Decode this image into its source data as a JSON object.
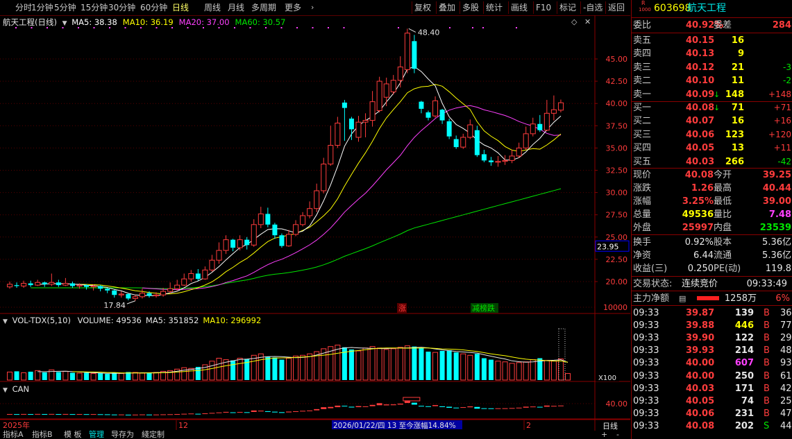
{
  "toolbar": {
    "periods": [
      "分时",
      "1分钟",
      "5分钟",
      "15分钟",
      "30分钟",
      "60分钟",
      "日线",
      "周线",
      "月线",
      "多周期",
      "更多"
    ],
    "active_period": "日线",
    "tools": [
      "复权",
      "叠加",
      "多股",
      "统计",
      "画线",
      "F10",
      "标记",
      "-自选",
      "返回"
    ]
  },
  "main_chart": {
    "stock_label": "航天工程(日线)",
    "ma_items": [
      {
        "label": "MA5: 38.38",
        "color": "#ffffff"
      },
      {
        "label": "MA10: 36.19",
        "color": "#ffff00"
      },
      {
        "label": "MA20: 37.00",
        "color": "#ff40ff"
      },
      {
        "label": "MA60: 30.57",
        "color": "#00e600"
      }
    ],
    "high_label": "48.40",
    "low_label": "17.84",
    "y_ticks": [
      "45.00",
      "42.50",
      "40.00",
      "37.50",
      "35.00",
      "32.50",
      "30.00",
      "27.50",
      "25.00",
      "22.50",
      "20.00"
    ],
    "price_tag": "23.95",
    "tag_zhang": "涨",
    "tag_longhu": "减榜跌"
  },
  "vol_chart": {
    "title": "VOL-TDX(5,10)",
    "items": [
      {
        "label": "VOLUME: 49536",
        "color": "#e6e6e6"
      },
      {
        "label": "MA5: 351852",
        "color": "#e6e6e6"
      },
      {
        "label": "MA10: 296992",
        "color": "#ffff00"
      }
    ],
    "y_tick": "10000",
    "unit": "X100"
  },
  "can_chart": {
    "title": "CAN",
    "y_tick": "40.00"
  },
  "x_axis": {
    "year_label": "2025年",
    "m1": "12",
    "m2": "2",
    "tooltip": "2026/01/22/四 13 至今涨幅14.84%",
    "period_label": "日线"
  },
  "bottom_tabs": [
    "指标A",
    "指标B",
    "模 板",
    "管理",
    "导存为",
    "綫定制"
  ],
  "bottom_right": [
    "+",
    "-"
  ],
  "quote": {
    "code": "603698",
    "name": "航天工程",
    "badge_top": "R",
    "badge_bottom": "1000",
    "weibi_label": "委比",
    "weibi": "40.92%",
    "weicha_label": "委差",
    "weicha": "284",
    "sell": [
      {
        "label": "卖五",
        "price": "40.15",
        "vol": "16",
        "chg": ""
      },
      {
        "label": "卖四",
        "price": "40.13",
        "vol": "9",
        "chg": ""
      },
      {
        "label": "卖三",
        "price": "40.12",
        "vol": "21",
        "chg": "-3"
      },
      {
        "label": "卖二",
        "price": "40.10",
        "vol": "11",
        "chg": "-2"
      },
      {
        "label": "卖一",
        "price": "40.09",
        "vol": "148",
        "chg": "+148"
      }
    ],
    "buy": [
      {
        "label": "买一",
        "price": "40.08",
        "vol": "71",
        "chg": "+71"
      },
      {
        "label": "买二",
        "price": "40.07",
        "vol": "16",
        "chg": "+16"
      },
      {
        "label": "买三",
        "price": "40.06",
        "vol": "123",
        "chg": "+120"
      },
      {
        "label": "买四",
        "price": "40.05",
        "vol": "13",
        "chg": "+11"
      },
      {
        "label": "买五",
        "price": "40.03",
        "vol": "266",
        "chg": "-42"
      }
    ],
    "stats": [
      {
        "l1": "现价",
        "v1": "40.08",
        "c1": "red",
        "l2": "今开",
        "v2": "39.25",
        "c2": "red"
      },
      {
        "l1": "涨跌",
        "v1": "1.26",
        "c1": "red",
        "l2": "最高",
        "v2": "40.44",
        "c2": "red"
      },
      {
        "l1": "涨幅",
        "v1": "3.25%",
        "c1": "red",
        "l2": "最低",
        "v2": "39.00",
        "c2": "red"
      },
      {
        "l1": "总量",
        "v1": "49536",
        "c1": "yellow",
        "l2": "量比",
        "v2": "7.48",
        "c2": "magenta"
      },
      {
        "l1": "外盘",
        "v1": "25997",
        "c1": "red",
        "l2": "内盘",
        "v2": "23539",
        "c2": "green"
      }
    ],
    "stats2": [
      {
        "l1": "换手",
        "v1": "0.92%",
        "l2": "股本",
        "v2": "5.36亿"
      },
      {
        "l1": "净资",
        "v1": "6.44",
        "l2": "流通",
        "v2": "5.36亿"
      },
      {
        "l1": "收益(三)",
        "v1": "0.250",
        "l2": "PE(动)",
        "v2": "119.8"
      }
    ],
    "trade_status_label": "交易状态:",
    "trade_status": "连续竞价",
    "trade_time": "09:33:49",
    "main_net_label": "主力净额",
    "main_net": "1258万",
    "main_net_pct": "6%",
    "ticks": [
      {
        "t": "09:33",
        "p": "39.87",
        "v": "139",
        "s": "B",
        "n": "36",
        "vc": "white"
      },
      {
        "t": "09:33",
        "p": "39.88",
        "v": "446",
        "s": "B",
        "n": "77",
        "vc": "yellow"
      },
      {
        "t": "09:33",
        "p": "39.90",
        "v": "122",
        "s": "B",
        "n": "29",
        "vc": "white"
      },
      {
        "t": "09:33",
        "p": "39.93",
        "v": "214",
        "s": "B",
        "n": "48",
        "vc": "white"
      },
      {
        "t": "09:33",
        "p": "40.00",
        "v": "607",
        "s": "B",
        "n": "93",
        "vc": "magenta"
      },
      {
        "t": "09:33",
        "p": "40.00",
        "v": "250",
        "s": "B",
        "n": "61",
        "vc": "white"
      },
      {
        "t": "09:33",
        "p": "40.03",
        "v": "171",
        "s": "B",
        "n": "42",
        "vc": "white"
      },
      {
        "t": "09:33",
        "p": "40.05",
        "v": "74",
        "s": "B",
        "n": "25",
        "vc": "white"
      },
      {
        "t": "09:33",
        "p": "40.06",
        "v": "231",
        "s": "B",
        "n": "47",
        "vc": "white"
      },
      {
        "t": "09:33",
        "p": "40.08",
        "v": "202",
        "s": "S",
        "n": "44",
        "vc": "white"
      }
    ]
  },
  "colors": {
    "up": "#ff3c3c",
    "down": "#00ffff",
    "ma5": "#ffffff",
    "ma10": "#ffff00",
    "ma20": "#ff40ff",
    "ma60": "#00e600",
    "grid": "#5a0000"
  },
  "chart_data": {
    "type": "candlestick",
    "y_range": [
      17.0,
      49.0
    ],
    "candles": [
      {
        "o": 19.4,
        "c": 19.7,
        "h": 20.0,
        "l": 19.2
      },
      {
        "o": 19.6,
        "c": 19.5,
        "h": 19.9,
        "l": 19.3
      },
      {
        "o": 19.5,
        "c": 19.8,
        "h": 20.1,
        "l": 19.3
      },
      {
        "o": 19.8,
        "c": 19.6,
        "h": 20.1,
        "l": 19.4
      },
      {
        "o": 19.6,
        "c": 19.9,
        "h": 20.2,
        "l": 19.5
      },
      {
        "o": 19.9,
        "c": 19.7,
        "h": 20.0,
        "l": 19.4
      },
      {
        "o": 19.7,
        "c": 19.9,
        "h": 20.9,
        "l": 19.5
      },
      {
        "o": 19.9,
        "c": 19.6,
        "h": 20.2,
        "l": 19.4
      },
      {
        "o": 19.6,
        "c": 19.8,
        "h": 20.4,
        "l": 19.5
      },
      {
        "o": 19.8,
        "c": 19.5,
        "h": 20.0,
        "l": 19.3
      },
      {
        "o": 19.5,
        "c": 19.6,
        "h": 19.8,
        "l": 19.2
      },
      {
        "o": 19.6,
        "c": 19.4,
        "h": 19.7,
        "l": 19.1
      },
      {
        "o": 19.4,
        "c": 19.5,
        "h": 19.7,
        "l": 19.0
      },
      {
        "o": 19.5,
        "c": 19.2,
        "h": 19.6,
        "l": 18.9
      },
      {
        "o": 19.2,
        "c": 19.0,
        "h": 19.3,
        "l": 18.7
      },
      {
        "o": 19.0,
        "c": 18.5,
        "h": 19.1,
        "l": 18.2
      },
      {
        "o": 18.5,
        "c": 18.6,
        "h": 18.9,
        "l": 18.2
      },
      {
        "o": 18.6,
        "c": 18.1,
        "h": 18.7,
        "l": 17.9
      },
      {
        "o": 18.1,
        "c": 18.3,
        "h": 18.5,
        "l": 17.84
      },
      {
        "o": 18.3,
        "c": 18.7,
        "h": 19.2,
        "l": 18.1
      },
      {
        "o": 18.7,
        "c": 18.4,
        "h": 18.9,
        "l": 18.2
      },
      {
        "o": 18.4,
        "c": 18.5,
        "h": 18.8,
        "l": 18.2
      },
      {
        "o": 18.5,
        "c": 18.9,
        "h": 19.3,
        "l": 18.3
      },
      {
        "o": 18.9,
        "c": 19.2,
        "h": 19.9,
        "l": 18.7
      },
      {
        "o": 19.2,
        "c": 19.6,
        "h": 20.2,
        "l": 19.0
      },
      {
        "o": 19.6,
        "c": 20.3,
        "h": 20.9,
        "l": 19.5
      },
      {
        "o": 20.3,
        "c": 20.9,
        "h": 21.3,
        "l": 20.0
      },
      {
        "o": 20.9,
        "c": 20.3,
        "h": 21.4,
        "l": 20.1
      },
      {
        "o": 20.3,
        "c": 21.3,
        "h": 21.7,
        "l": 20.2
      },
      {
        "o": 21.3,
        "c": 22.4,
        "h": 23.0,
        "l": 21.1
      },
      {
        "o": 22.4,
        "c": 23.5,
        "h": 24.4,
        "l": 22.0
      },
      {
        "o": 23.5,
        "c": 24.7,
        "h": 25.2,
        "l": 23.1
      },
      {
        "o": 24.7,
        "c": 23.8,
        "h": 24.8,
        "l": 23.4
      },
      {
        "o": 23.8,
        "c": 24.7,
        "h": 25.2,
        "l": 23.5
      },
      {
        "o": 24.7,
        "c": 24.1,
        "h": 25.0,
        "l": 23.6
      },
      {
        "o": 24.1,
        "c": 26.4,
        "h": 27.0,
        "l": 23.9
      },
      {
        "o": 26.4,
        "c": 27.6,
        "h": 28.4,
        "l": 26.0
      },
      {
        "o": 27.6,
        "c": 26.4,
        "h": 28.3,
        "l": 26.1
      },
      {
        "o": 26.4,
        "c": 25.2,
        "h": 26.6,
        "l": 24.8
      },
      {
        "o": 25.2,
        "c": 24.0,
        "h": 25.4,
        "l": 23.8
      },
      {
        "o": 24.0,
        "c": 25.3,
        "h": 25.8,
        "l": 23.9
      },
      {
        "o": 25.3,
        "c": 26.4,
        "h": 26.9,
        "l": 25.1
      },
      {
        "o": 26.4,
        "c": 27.4,
        "h": 27.8,
        "l": 26.2
      },
      {
        "o": 27.4,
        "c": 28.2,
        "h": 29.0,
        "l": 27.1
      },
      {
        "o": 28.2,
        "c": 30.2,
        "h": 31.0,
        "l": 27.8
      },
      {
        "o": 30.2,
        "c": 33.2,
        "h": 33.9,
        "l": 29.9
      },
      {
        "o": 33.2,
        "c": 35.3,
        "h": 37.5,
        "l": 33.0
      },
      {
        "o": 35.3,
        "c": 37.8,
        "h": 38.5,
        "l": 35.0
      },
      {
        "o": 40.1,
        "c": 39.5,
        "h": 40.4,
        "l": 35.8
      },
      {
        "o": 38.3,
        "c": 37.1,
        "h": 38.5,
        "l": 35.9
      },
      {
        "o": 36.2,
        "c": 37.9,
        "h": 38.6,
        "l": 35.7
      },
      {
        "o": 37.9,
        "c": 38.1,
        "h": 38.9,
        "l": 36.2
      },
      {
        "o": 38.1,
        "c": 40.2,
        "h": 41.4,
        "l": 37.4
      },
      {
        "o": 39.2,
        "c": 42.5,
        "h": 43.0,
        "l": 39.0
      },
      {
        "o": 40.7,
        "c": 42.2,
        "h": 42.9,
        "l": 39.7
      },
      {
        "o": 41.3,
        "c": 42.6,
        "h": 43.2,
        "l": 41.0
      },
      {
        "o": 42.6,
        "c": 44.1,
        "h": 45.3,
        "l": 41.8
      },
      {
        "o": 43.8,
        "c": 47.9,
        "h": 48.4,
        "l": 43.4
      },
      {
        "o": 47.0,
        "c": 43.9,
        "h": 47.7,
        "l": 43.4
      },
      {
        "o": 40.2,
        "c": 39.4,
        "h": 40.3,
        "l": 38.9
      },
      {
        "o": 39.0,
        "c": 38.4,
        "h": 39.2,
        "l": 38.1
      },
      {
        "o": 38.6,
        "c": 40.3,
        "h": 40.8,
        "l": 38.4
      },
      {
        "o": 39.3,
        "c": 38.1,
        "h": 39.4,
        "l": 37.7
      },
      {
        "o": 38.0,
        "c": 36.3,
        "h": 38.3,
        "l": 36.0
      },
      {
        "o": 36.0,
        "c": 35.1,
        "h": 36.4,
        "l": 34.9
      },
      {
        "o": 35.1,
        "c": 36.2,
        "h": 36.6,
        "l": 34.9
      },
      {
        "o": 36.2,
        "c": 37.6,
        "h": 38.2,
        "l": 36.0
      },
      {
        "o": 37.0,
        "c": 34.2,
        "h": 37.5,
        "l": 34.0
      },
      {
        "o": 34.3,
        "c": 33.6,
        "h": 34.8,
        "l": 33.4
      },
      {
        "o": 33.6,
        "c": 33.4,
        "h": 34.0,
        "l": 33.0
      },
      {
        "o": 33.4,
        "c": 33.5,
        "h": 34.1,
        "l": 32.9
      },
      {
        "o": 33.5,
        "c": 33.6,
        "h": 34.2,
        "l": 33.1
      },
      {
        "o": 33.6,
        "c": 34.1,
        "h": 34.8,
        "l": 33.3
      },
      {
        "o": 34.1,
        "c": 35.0,
        "h": 35.6,
        "l": 33.9
      },
      {
        "o": 35.0,
        "c": 36.6,
        "h": 37.4,
        "l": 34.8
      },
      {
        "o": 36.6,
        "c": 37.7,
        "h": 38.4,
        "l": 36.3
      },
      {
        "o": 37.7,
        "c": 37.0,
        "h": 38.7,
        "l": 36.8
      },
      {
        "o": 37.0,
        "c": 38.9,
        "h": 40.4,
        "l": 36.9
      },
      {
        "o": 38.9,
        "c": 39.3,
        "h": 40.9,
        "l": 38.1
      },
      {
        "o": 39.25,
        "c": 40.08,
        "h": 40.44,
        "l": 39.0
      }
    ],
    "volumes": [
      1100,
      1200,
      1000,
      1150,
      1300,
      1050,
      1400,
      1100,
      1200,
      1000,
      950,
      1000,
      900,
      950,
      850,
      1000,
      900,
      1100,
      1050,
      950,
      1000,
      1050,
      1200,
      1300,
      1500,
      1700,
      1600,
      1800,
      2100,
      2600,
      3000,
      2800,
      2700,
      3000,
      2900,
      3400,
      3600,
      3200,
      3100,
      2800,
      3000,
      3300,
      3400,
      3600,
      3900,
      4300,
      4600,
      4800,
      4500,
      4200,
      4000,
      4400,
      4600,
      4400,
      4200,
      4300,
      4500,
      4700,
      4600,
      4400,
      3900,
      3800,
      4000,
      4100,
      3800,
      3600,
      3400,
      3600,
      3000,
      2800,
      2600,
      2500,
      2300,
      2400,
      2500,
      2800,
      3000,
      2700,
      2600,
      2900,
      900
    ],
    "ylabel": "",
    "xlabel": ""
  }
}
